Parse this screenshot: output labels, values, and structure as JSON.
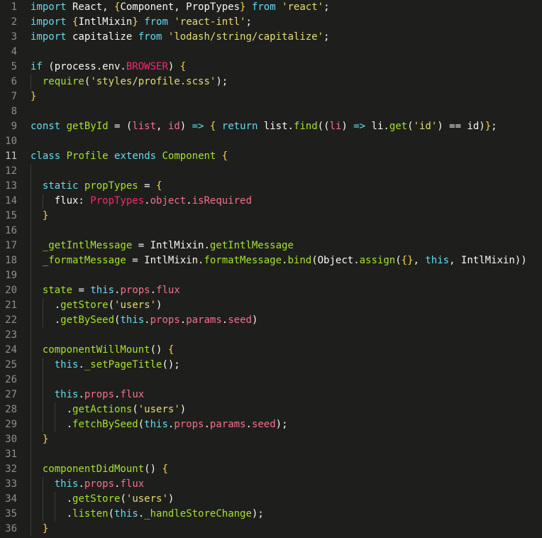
{
  "editor": {
    "lines": [
      {
        "num": "1",
        "indent": 0,
        "tokens": [
          [
            "kw",
            "import"
          ],
          [
            "plain",
            " React, "
          ],
          [
            "brace",
            "{"
          ],
          [
            "plain",
            "Component, PropTypes"
          ],
          [
            "brace",
            "}"
          ],
          [
            "plain",
            " "
          ],
          [
            "kw",
            "from"
          ],
          [
            "plain",
            " "
          ],
          [
            "str",
            "'react'"
          ],
          [
            "plain",
            ";"
          ]
        ]
      },
      {
        "num": "2",
        "indent": 0,
        "tokens": [
          [
            "kw",
            "import"
          ],
          [
            "plain",
            " "
          ],
          [
            "brace",
            "{"
          ],
          [
            "plain",
            "IntlMixin"
          ],
          [
            "brace",
            "}"
          ],
          [
            "plain",
            " "
          ],
          [
            "kw",
            "from"
          ],
          [
            "plain",
            " "
          ],
          [
            "str",
            "'react-intl'"
          ],
          [
            "plain",
            ";"
          ]
        ]
      },
      {
        "num": "3",
        "indent": 0,
        "tokens": [
          [
            "kw",
            "import"
          ],
          [
            "plain",
            " capitalize "
          ],
          [
            "kw",
            "from"
          ],
          [
            "plain",
            " "
          ],
          [
            "str",
            "'lodash/string/capitalize'"
          ],
          [
            "plain",
            ";"
          ]
        ]
      },
      {
        "num": "4",
        "indent": 0,
        "tokens": []
      },
      {
        "num": "5",
        "indent": 0,
        "tokens": [
          [
            "kw",
            "if"
          ],
          [
            "plain",
            " (process.env."
          ],
          [
            "red",
            "BROWSER"
          ],
          [
            "plain",
            ") "
          ],
          [
            "brace",
            "{"
          ]
        ]
      },
      {
        "num": "6",
        "indent": 1,
        "tokens": [
          [
            "plain",
            "  "
          ],
          [
            "green",
            "require"
          ],
          [
            "plain",
            "("
          ],
          [
            "str",
            "'styles/profile.scss'"
          ],
          [
            "plain",
            ");"
          ]
        ]
      },
      {
        "num": "7",
        "indent": 0,
        "tokens": [
          [
            "brace",
            "}"
          ]
        ]
      },
      {
        "num": "8",
        "indent": 0,
        "tokens": []
      },
      {
        "num": "9",
        "indent": 0,
        "tokens": [
          [
            "kw",
            "const"
          ],
          [
            "plain",
            " "
          ],
          [
            "green",
            "getById"
          ],
          [
            "plain",
            " = ("
          ],
          [
            "pink",
            "list"
          ],
          [
            "plain",
            ", "
          ],
          [
            "pink",
            "id"
          ],
          [
            "plain",
            ") "
          ],
          [
            "kw",
            "=>"
          ],
          [
            "plain",
            " "
          ],
          [
            "brace",
            "{"
          ],
          [
            "plain",
            " "
          ],
          [
            "kw",
            "return"
          ],
          [
            "plain",
            " list."
          ],
          [
            "green",
            "find"
          ],
          [
            "plain",
            "(("
          ],
          [
            "pink",
            "li"
          ],
          [
            "plain",
            ") "
          ],
          [
            "kw",
            "=>"
          ],
          [
            "plain",
            " li."
          ],
          [
            "green",
            "get"
          ],
          [
            "plain",
            "("
          ],
          [
            "str",
            "'id'"
          ],
          [
            "plain",
            ") == id)"
          ],
          [
            "brace",
            "}"
          ],
          [
            "plain",
            ";"
          ]
        ]
      },
      {
        "num": "10",
        "indent": 0,
        "tokens": []
      },
      {
        "num": "11",
        "indent": 0,
        "active": true,
        "tokens": [
          [
            "kw",
            "class"
          ],
          [
            "plain",
            " "
          ],
          [
            "green",
            "Profile"
          ],
          [
            "plain",
            " "
          ],
          [
            "kw",
            "extends"
          ],
          [
            "plain",
            " "
          ],
          [
            "green",
            "Component"
          ],
          [
            "plain",
            " "
          ],
          [
            "brace",
            "{"
          ]
        ]
      },
      {
        "num": "12",
        "indent": 1,
        "tokens": []
      },
      {
        "num": "13",
        "indent": 1,
        "tokens": [
          [
            "plain",
            "  "
          ],
          [
            "kw",
            "static"
          ],
          [
            "plain",
            " "
          ],
          [
            "green",
            "propTypes"
          ],
          [
            "plain",
            " = "
          ],
          [
            "brace",
            "{"
          ]
        ]
      },
      {
        "num": "14",
        "indent": 2,
        "tokens": [
          [
            "plain",
            "    flux: "
          ],
          [
            "red",
            "PropTypes"
          ],
          [
            "plain",
            "."
          ],
          [
            "pink",
            "object"
          ],
          [
            "plain",
            "."
          ],
          [
            "pink",
            "isRequired"
          ]
        ]
      },
      {
        "num": "15",
        "indent": 1,
        "tokens": [
          [
            "plain",
            "  "
          ],
          [
            "brace",
            "}"
          ]
        ]
      },
      {
        "num": "16",
        "indent": 1,
        "tokens": []
      },
      {
        "num": "17",
        "indent": 1,
        "tokens": [
          [
            "plain",
            "  "
          ],
          [
            "green",
            "_getIntlMessage"
          ],
          [
            "plain",
            " = IntlMixin."
          ],
          [
            "green",
            "getIntlMessage"
          ]
        ]
      },
      {
        "num": "18",
        "indent": 1,
        "tokens": [
          [
            "plain",
            "  "
          ],
          [
            "green",
            "_formatMessage"
          ],
          [
            "plain",
            " = IntlMixin."
          ],
          [
            "green",
            "formatMessage"
          ],
          [
            "plain",
            "."
          ],
          [
            "green",
            "bind"
          ],
          [
            "plain",
            "(Object."
          ],
          [
            "green",
            "assign"
          ],
          [
            "plain",
            "("
          ],
          [
            "brace",
            "{}"
          ],
          [
            "plain",
            ", "
          ],
          [
            "kw",
            "this"
          ],
          [
            "plain",
            ", IntlMixin))"
          ]
        ]
      },
      {
        "num": "19",
        "indent": 1,
        "tokens": []
      },
      {
        "num": "20",
        "indent": 1,
        "tokens": [
          [
            "plain",
            "  "
          ],
          [
            "green",
            "state"
          ],
          [
            "plain",
            " = "
          ],
          [
            "kw",
            "this"
          ],
          [
            "plain",
            "."
          ],
          [
            "pink",
            "props"
          ],
          [
            "plain",
            "."
          ],
          [
            "pink",
            "flux"
          ]
        ]
      },
      {
        "num": "21",
        "indent": 2,
        "tokens": [
          [
            "plain",
            "    ."
          ],
          [
            "green",
            "getStore"
          ],
          [
            "plain",
            "("
          ],
          [
            "str",
            "'users'"
          ],
          [
            "plain",
            ")"
          ]
        ]
      },
      {
        "num": "22",
        "indent": 2,
        "tokens": [
          [
            "plain",
            "    ."
          ],
          [
            "green",
            "getBySeed"
          ],
          [
            "plain",
            "("
          ],
          [
            "kw",
            "this"
          ],
          [
            "plain",
            "."
          ],
          [
            "pink",
            "props"
          ],
          [
            "plain",
            "."
          ],
          [
            "pink",
            "params"
          ],
          [
            "plain",
            "."
          ],
          [
            "pink",
            "seed"
          ],
          [
            "plain",
            ")"
          ]
        ]
      },
      {
        "num": "23",
        "indent": 1,
        "tokens": []
      },
      {
        "num": "24",
        "indent": 1,
        "tokens": [
          [
            "plain",
            "  "
          ],
          [
            "green",
            "componentWillMount"
          ],
          [
            "plain",
            "() "
          ],
          [
            "brace",
            "{"
          ]
        ]
      },
      {
        "num": "25",
        "indent": 2,
        "tokens": [
          [
            "plain",
            "    "
          ],
          [
            "kw",
            "this"
          ],
          [
            "plain",
            "."
          ],
          [
            "green",
            "_setPageTitle"
          ],
          [
            "plain",
            "();"
          ]
        ]
      },
      {
        "num": "26",
        "indent": 2,
        "tokens": []
      },
      {
        "num": "27",
        "indent": 2,
        "tokens": [
          [
            "plain",
            "    "
          ],
          [
            "kw",
            "this"
          ],
          [
            "plain",
            "."
          ],
          [
            "pink",
            "props"
          ],
          [
            "plain",
            "."
          ],
          [
            "pink",
            "flux"
          ]
        ]
      },
      {
        "num": "28",
        "indent": 3,
        "tokens": [
          [
            "plain",
            "      ."
          ],
          [
            "green",
            "getActions"
          ],
          [
            "plain",
            "("
          ],
          [
            "str",
            "'users'"
          ],
          [
            "plain",
            ")"
          ]
        ]
      },
      {
        "num": "29",
        "indent": 3,
        "tokens": [
          [
            "plain",
            "      ."
          ],
          [
            "green",
            "fetchBySeed"
          ],
          [
            "plain",
            "("
          ],
          [
            "kw",
            "this"
          ],
          [
            "plain",
            "."
          ],
          [
            "pink",
            "props"
          ],
          [
            "plain",
            "."
          ],
          [
            "pink",
            "params"
          ],
          [
            "plain",
            "."
          ],
          [
            "pink",
            "seed"
          ],
          [
            "plain",
            ");"
          ]
        ]
      },
      {
        "num": "30",
        "indent": 1,
        "tokens": [
          [
            "plain",
            "  "
          ],
          [
            "brace",
            "}"
          ]
        ]
      },
      {
        "num": "31",
        "indent": 1,
        "tokens": []
      },
      {
        "num": "32",
        "indent": 1,
        "tokens": [
          [
            "plain",
            "  "
          ],
          [
            "green",
            "componentDidMount"
          ],
          [
            "plain",
            "() "
          ],
          [
            "brace",
            "{"
          ]
        ]
      },
      {
        "num": "33",
        "indent": 2,
        "tokens": [
          [
            "plain",
            "    "
          ],
          [
            "kw",
            "this"
          ],
          [
            "plain",
            "."
          ],
          [
            "pink",
            "props"
          ],
          [
            "plain",
            "."
          ],
          [
            "pink",
            "flux"
          ]
        ]
      },
      {
        "num": "34",
        "indent": 3,
        "tokens": [
          [
            "plain",
            "      ."
          ],
          [
            "green",
            "getStore"
          ],
          [
            "plain",
            "("
          ],
          [
            "str",
            "'users'"
          ],
          [
            "plain",
            ")"
          ]
        ]
      },
      {
        "num": "35",
        "indent": 3,
        "tokens": [
          [
            "plain",
            "      ."
          ],
          [
            "green",
            "listen"
          ],
          [
            "plain",
            "("
          ],
          [
            "kw",
            "this"
          ],
          [
            "plain",
            "."
          ],
          [
            "green",
            "_handleStoreChange"
          ],
          [
            "plain",
            ");"
          ]
        ]
      },
      {
        "num": "36",
        "indent": 1,
        "tokens": [
          [
            "plain",
            "  "
          ],
          [
            "brace",
            "}"
          ]
        ]
      }
    ]
  },
  "colors": {
    "background": "#1e1f1c",
    "keyword": "#66d9ef",
    "string": "#e6db74",
    "function": "#a6e22e",
    "constant": "#f92672",
    "gutter": "#8f908a"
  }
}
